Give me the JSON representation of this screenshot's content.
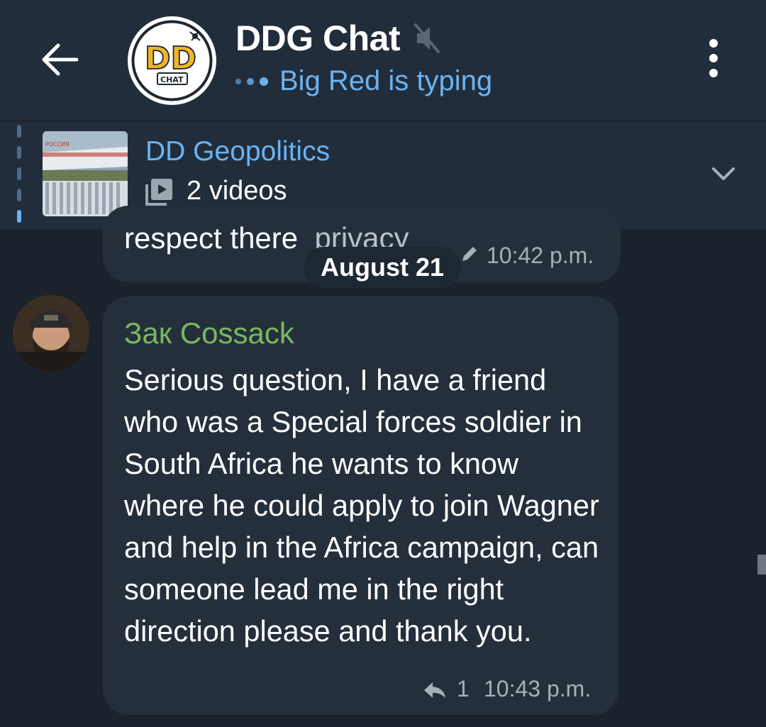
{
  "header": {
    "title": "DDG Chat",
    "status": "Big Red is typing",
    "avatar_text": "DD",
    "avatar_subtext": "CHAT",
    "icons": {
      "back": "back-arrow-icon",
      "mute": "muted-speaker-icon",
      "menu": "more-vertical-icon"
    }
  },
  "pinned": {
    "title": "DD Geopolitics",
    "subtitle": "2 videos",
    "thumb_text": "РОССИЯ",
    "icons": {
      "media": "video-gallery-icon",
      "expand": "chevron-down-icon"
    }
  },
  "date_separator": "August 21",
  "messages": [
    {
      "text": "respect there",
      "text_faded": "privacy",
      "edited": true,
      "time": "10:42 p.m."
    },
    {
      "sender": "Зак Cossack",
      "sender_color": "#78b95e",
      "text": "Serious question, I have a friend who was a Special forces soldier in South Africa he wants to know where he could apply to join Wagner and help in the Africa campaign, can someone lead me in the right direction please and thank you.",
      "replies": "1",
      "time": "10:43 p.m."
    }
  ],
  "colors": {
    "accent": "#6ab3f3",
    "background": "#1a222c",
    "header": "#222d3b",
    "bubble": "#252f3c"
  }
}
